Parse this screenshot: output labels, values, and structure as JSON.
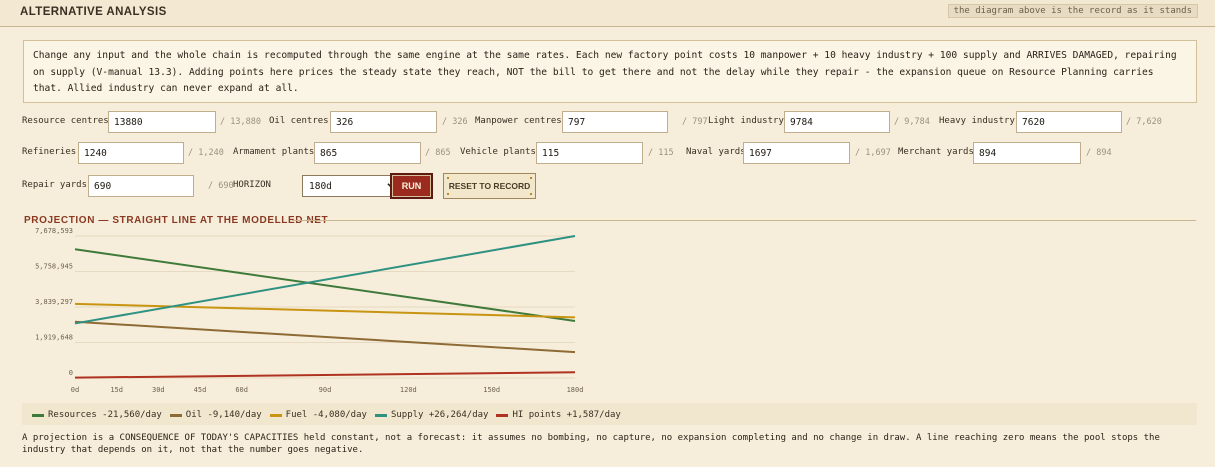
{
  "header": {
    "title": "ALTERNATIVE ANALYSIS",
    "note": "the diagram above is the record as it stands"
  },
  "intro": {
    "text": "Change any input and the whole chain is recomputed through the same engine at the same rates. Each new factory point costs 10 manpower + 10 heavy industry + 100 supply and ARRIVES DAMAGED, repairing on supply (V-manual 13.3). Adding points here prices the steady state they reach, NOT the bill to get there and not the delay while they repair - the expansion queue on Resource Planning carries that. Allied industry can never expand at all."
  },
  "fields": {
    "resource_centres": {
      "label": "Resource centres",
      "value": "13880",
      "max": "/ 13,880"
    },
    "oil_centres": {
      "label": "Oil centres",
      "value": "326",
      "max": "/ 326"
    },
    "manpower_centres": {
      "label": "Manpower centres",
      "value": "797",
      "max": "/ 797"
    },
    "light_industry": {
      "label": "Light industry",
      "value": "9784",
      "max": "/ 9,784"
    },
    "heavy_industry": {
      "label": "Heavy industry",
      "value": "7620",
      "max": "/ 7,620"
    },
    "refineries": {
      "label": "Refineries",
      "value": "1240",
      "max": "/ 1,240"
    },
    "armament_plants": {
      "label": "Armament plants",
      "value": "865",
      "max": "/ 865"
    },
    "vehicle_plants": {
      "label": "Vehicle plants",
      "value": "115",
      "max": "/ 115"
    },
    "naval_yards": {
      "label": "Naval yards",
      "value": "1697",
      "max": "/ 1,697"
    },
    "merchant_yards": {
      "label": "Merchant yards",
      "value": "894",
      "max": "/ 894"
    },
    "repair_yards": {
      "label": "Repair yards",
      "value": "690",
      "max": "/ 690"
    }
  },
  "horizon": {
    "label": "HORIZON",
    "selected": "180d"
  },
  "buttons": {
    "run": "RUN",
    "reset": "RESET TO RECORD"
  },
  "projection": {
    "title": "PROJECTION — STRAIGHT LINE AT THE MODELLED NET"
  },
  "colors": {
    "resources": "#3f7a3a",
    "oil": "#8e6a35",
    "fuel": "#c89412",
    "supply": "#2e9181",
    "hi_points": "#b03220"
  },
  "chart_data": {
    "type": "line",
    "x": [
      0,
      180
    ],
    "x_ticks": [
      "0d",
      "15d",
      "30d",
      "45d",
      "60d",
      "90d",
      "120d",
      "150d",
      "180d"
    ],
    "x_tick_values": [
      0,
      15,
      30,
      45,
      60,
      90,
      120,
      150,
      180
    ],
    "y_ticks": [
      "0",
      "1,919,648",
      "3,839,297",
      "5,758,945",
      "7,678,593"
    ],
    "y_tick_values": [
      0,
      1919648,
      3839297,
      5758945,
      7678593
    ],
    "ylim": [
      0,
      7678593
    ],
    "xlim": [
      0,
      180
    ],
    "grid": true,
    "legend_position": "bottom",
    "series": [
      {
        "name": "Resources -21,560/day",
        "color": "#3f7a3a",
        "values": [
          6960000,
          3080000
        ]
      },
      {
        "name": "Oil -9,140/day",
        "color": "#8e6a35",
        "values": [
          3040000,
          1400000
        ]
      },
      {
        "name": "Fuel -4,080/day",
        "color": "#c89412",
        "values": [
          4010000,
          3280000
        ]
      },
      {
        "name": "Supply +26,264/day",
        "color": "#2e9181",
        "values": [
          2950000,
          7680000
        ]
      },
      {
        "name": "HI points +1,587/day",
        "color": "#b03220",
        "values": [
          20000,
          310000
        ]
      }
    ]
  },
  "footnote": "A projection is a CONSEQUENCE OF TODAY'S CAPACITIES held constant, not a forecast: it assumes no bombing, no capture, no expansion completing and no change in draw. A line reaching zero means the pool stops the industry that depends on it, not that the number goes negative."
}
